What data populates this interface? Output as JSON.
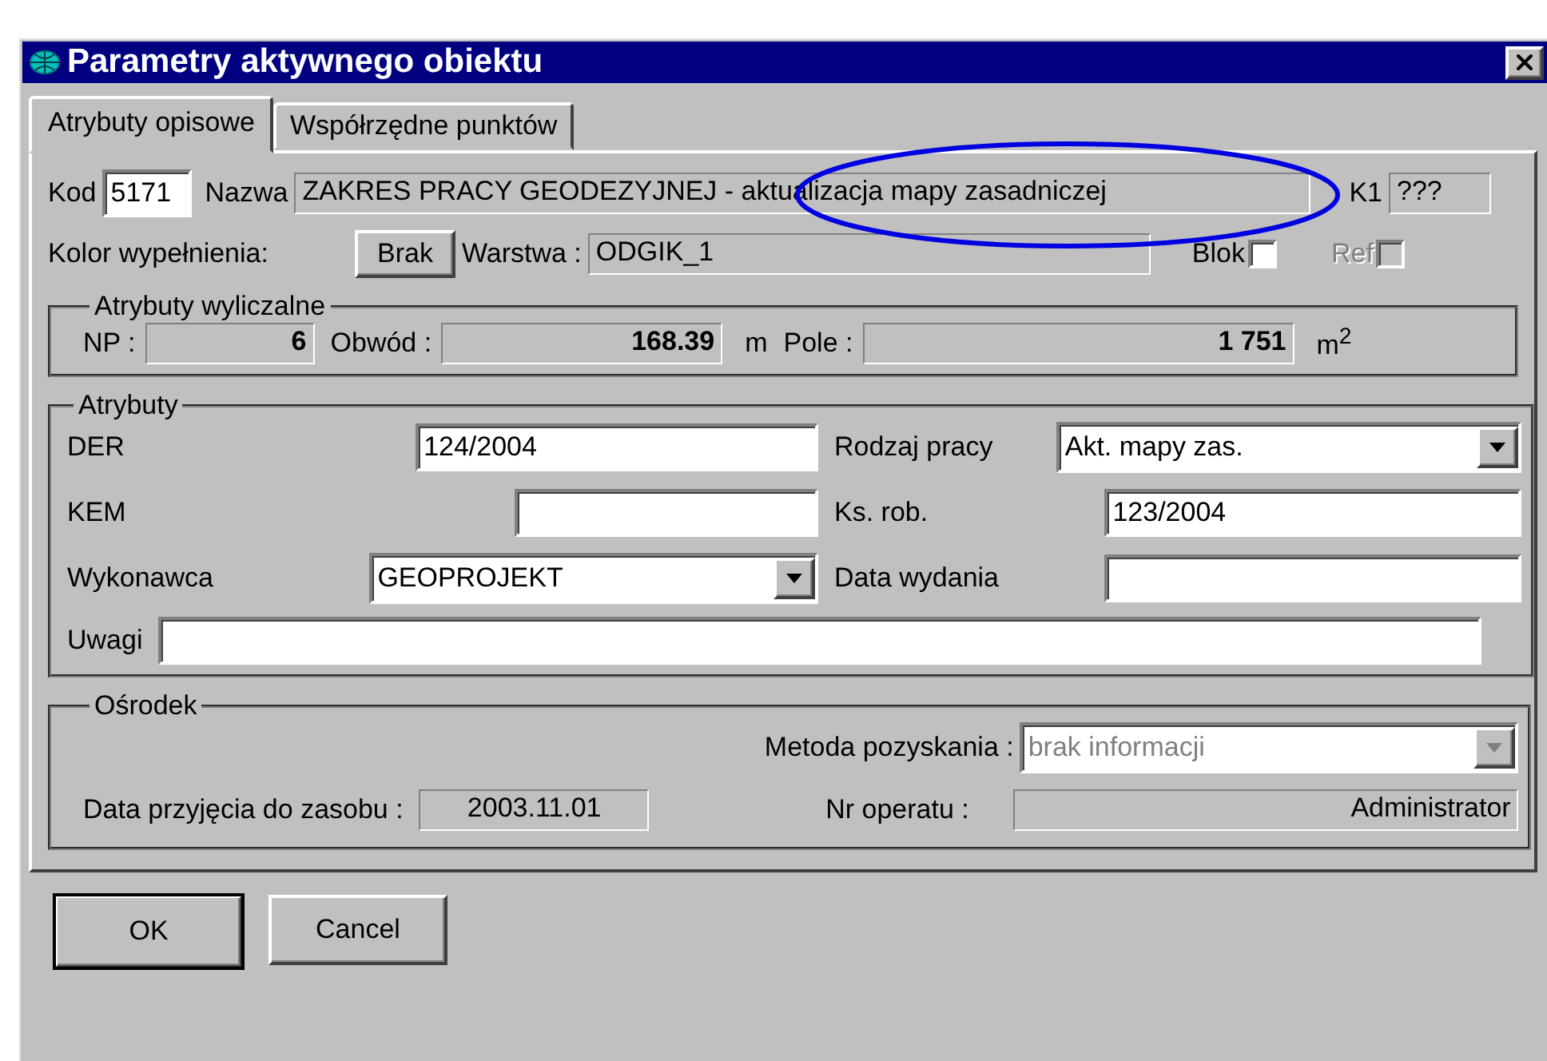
{
  "window": {
    "title": "Parametry aktywnego obiektu"
  },
  "tabs": [
    {
      "label": "Atrybuty opisowe",
      "selected": true
    },
    {
      "label": "Współrzędne punktów",
      "selected": false
    }
  ],
  "header": {
    "kod_label": "Kod",
    "kod": "5171",
    "nazwa_label": "Nazwa",
    "nazwa": "ZAKRES PRACY GEODEZYJNEJ - aktualizacja mapy zasadniczej",
    "k1_label": "K1",
    "k1": "???",
    "kolor_label": "Kolor wypełnienia:",
    "kolor_button": "Brak",
    "warstwa_label": "Warstwa :",
    "warstwa": "ODGIK_1",
    "checkboxes": [
      {
        "label": "Blok",
        "checked": false,
        "disabled": false
      },
      {
        "label": "Ref",
        "checked": false,
        "disabled": true
      }
    ]
  },
  "computed": {
    "title": "Atrybuty wyliczalne",
    "items": [
      {
        "label": "NP :",
        "value": "6"
      },
      {
        "label": "Obwód :",
        "value": "168.39",
        "unit": "m"
      },
      {
        "label": "Pole :",
        "value": "1 751",
        "unit": "m$^{2}$"
      }
    ]
  },
  "attributes": {
    "title": "Atrybuty",
    "left": [
      {
        "label": "DER",
        "kind": "text",
        "value": "124/2004"
      },
      {
        "label": "KEM",
        "kind": "text"
      },
      {
        "label": "Wykonawca",
        "kind": "combo",
        "value": "GEOPROJEKT"
      }
    ],
    "right": [
      {
        "label": "Rodzaj pracy",
        "kind": "combo",
        "value": "Akt. mapy zas."
      },
      {
        "label": "Ks. rob.",
        "kind": "text",
        "value": "123/2004"
      },
      {
        "label": "Data wydania",
        "kind": "text"
      }
    ],
    "notes_label": "Uwagi"
  },
  "center": {
    "title": "Ośrodek",
    "metoda_label": "Metoda pozyskania :",
    "metoda": "brak informacji",
    "metoda_disabled": true,
    "data_label": "Data przyjęcia do zasobu :",
    "data": "2003.11.01",
    "operat_label": "Nr operatu :",
    "operat": "Administrator"
  },
  "buttons": [
    {
      "label": "OK",
      "default": true
    },
    {
      "label": "Cancel",
      "default": false
    }
  ]
}
